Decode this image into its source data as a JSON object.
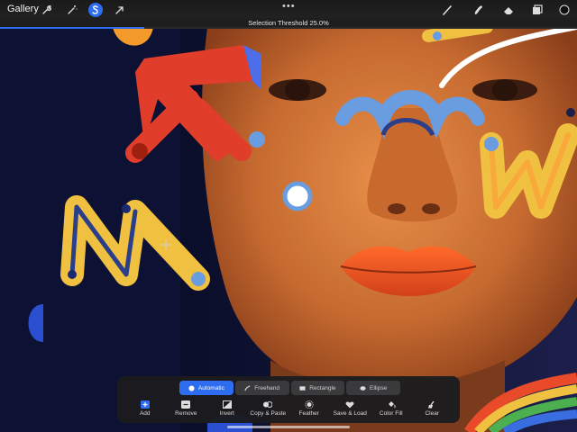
{
  "topbar": {
    "gallery_label": "Gallery",
    "tools_left": [
      {
        "icon": "wrench-icon",
        "active": false
      },
      {
        "icon": "magic-wand-icon",
        "active": false
      },
      {
        "icon": "selection-icon",
        "active": true
      },
      {
        "icon": "transform-arrow-icon",
        "active": false
      }
    ],
    "tools_right": [
      "brush-icon",
      "smudge-icon",
      "eraser-icon",
      "layers-icon",
      "color-swatch"
    ],
    "more_glyph": "•••"
  },
  "selection_threshold": {
    "label": "Selection Threshold 25.0%",
    "value_percent": 25.0
  },
  "selection_panel": {
    "modes": [
      {
        "label": "Automatic",
        "icon": "automatic-dot-icon",
        "active": true
      },
      {
        "label": "Freehand",
        "icon": "freehand-icon",
        "active": false
      },
      {
        "label": "Rectangle",
        "icon": "rectangle-icon",
        "active": false
      },
      {
        "label": "Ellipse",
        "icon": "ellipse-icon",
        "active": false
      }
    ],
    "actions": [
      {
        "label": "Add",
        "icon": "add-icon",
        "highlight": true
      },
      {
        "label": "Remove",
        "icon": "remove-icon"
      },
      {
        "label": "Invert",
        "icon": "invert-icon"
      },
      {
        "label": "Copy & Paste",
        "icon": "copy-paste-icon"
      },
      {
        "label": "Feather",
        "icon": "feather-icon"
      },
      {
        "label": "Save & Load",
        "icon": "heart-icon"
      },
      {
        "label": "Color Fill",
        "icon": "color-fill-icon"
      },
      {
        "label": "Clear",
        "icon": "clear-brush-icon"
      }
    ]
  },
  "colors": {
    "accent": "#2f6df0",
    "background": "#0d1133",
    "skin": "#d47a3a",
    "red_shape": "#e03d2a",
    "yellow_shape": "#f0c040",
    "blue_shape": "#6a9ce0"
  }
}
